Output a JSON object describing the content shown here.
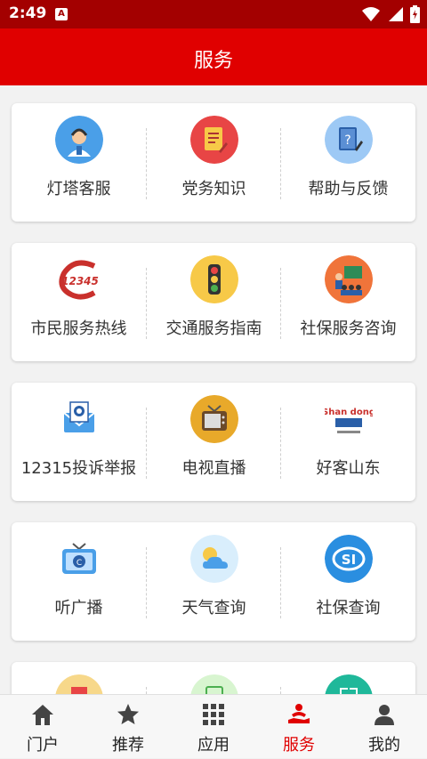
{
  "status_bar": {
    "time": "2:49",
    "notification_icon": "A"
  },
  "header": {
    "title": "服务"
  },
  "services": [
    [
      {
        "label": "灯塔客服",
        "icon": "customer-service-icon"
      },
      {
        "label": "党务知识",
        "icon": "notepad-icon"
      },
      {
        "label": "帮助与反馈",
        "icon": "help-feedback-icon"
      }
    ],
    [
      {
        "label": "市民服务热线",
        "icon": "hotline-12345-icon"
      },
      {
        "label": "交通服务指南",
        "icon": "traffic-light-icon"
      },
      {
        "label": "社保服务咨询",
        "icon": "consultation-icon"
      }
    ],
    [
      {
        "label": "12315投诉举报",
        "icon": "complaint-mail-icon"
      },
      {
        "label": "电视直播",
        "icon": "tv-icon"
      },
      {
        "label": "好客山东",
        "icon": "shandong-logo-icon"
      }
    ],
    [
      {
        "label": "听广播",
        "icon": "radio-icon"
      },
      {
        "label": "天气查询",
        "icon": "weather-icon"
      },
      {
        "label": "社保查询",
        "icon": "social-security-icon"
      }
    ]
  ],
  "hotline_logo_text": "12345",
  "shandong_logo_text": "Shan dong",
  "tabs": [
    {
      "label": "门户",
      "icon": "home-icon"
    },
    {
      "label": "推荐",
      "icon": "star-icon"
    },
    {
      "label": "应用",
      "icon": "grid-icon"
    },
    {
      "label": "服务",
      "icon": "service-icon",
      "active": true
    },
    {
      "label": "我的",
      "icon": "person-icon"
    }
  ],
  "colors": {
    "status_bar": "#a30000",
    "header": "#e00000",
    "active_tab": "#e00000"
  }
}
